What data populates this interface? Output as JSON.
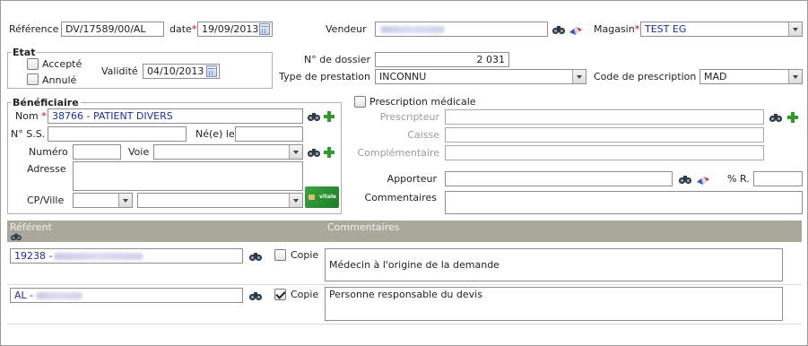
{
  "header": {
    "reference_label": "Référence",
    "reference_value": "DV/17589/00/AL",
    "date_label": "date",
    "date_value": "19/09/2013",
    "vendeur_label": "Vendeur",
    "magasin_label": "Magasin",
    "magasin_value": "TEST EG"
  },
  "etat": {
    "legend": "Etat",
    "accepte_label": "Accepté",
    "annule_label": "Annulé",
    "validite_label": "Validité",
    "validite_value": "04/10/2013"
  },
  "dossier": {
    "numero_label": "N° de dossier",
    "numero_value": "2 031",
    "type_label": "Type de prestation",
    "type_value": "INCONNU",
    "code_label": "Code de prescription",
    "code_value": "MAD"
  },
  "beneficiaire": {
    "legend": "Bénéficiaire",
    "nom_label": "Nom",
    "nom_value": "38766 - PATIENT DIVERS",
    "ss_label": "N° S.S.",
    "ne_label": "Né(e) le",
    "numero_label": "Numéro",
    "voie_label": "Voie",
    "adresse_label": "Adresse",
    "cp_label": "CP/Ville",
    "card_text": "vitale"
  },
  "prescription": {
    "checkbox_label": "Prescription médicale",
    "prescripteur_label": "Prescripteur",
    "caisse_label": "Caisse",
    "complementaire_label": "Complémentaire",
    "apporteur_label": "Apporteur",
    "pct_label": "% R.",
    "commentaires_label": "Commentaires"
  },
  "referents": {
    "col_referent": "Référent",
    "col_commentaires": "Commentaires",
    "rows": [
      {
        "code": "19238 -",
        "copie_label": "Copie",
        "copie_checked": false,
        "comment": "Médecin à l'origine de la demande"
      },
      {
        "code": "AL -",
        "copie_label": "Copie",
        "copie_checked": true,
        "comment": "Personne responsable du devis"
      }
    ]
  },
  "icons": {
    "search": "binoculars-icon",
    "clear": "eraser-icon",
    "add": "plus-icon",
    "calendar": "calendar-icon",
    "card": "carte-vitale-icon"
  },
  "colors": {
    "accent_text": "#1a2fa0",
    "required": "#dd0000",
    "add_green": "#2f9a2f",
    "grid_header": "#aaa79b"
  }
}
